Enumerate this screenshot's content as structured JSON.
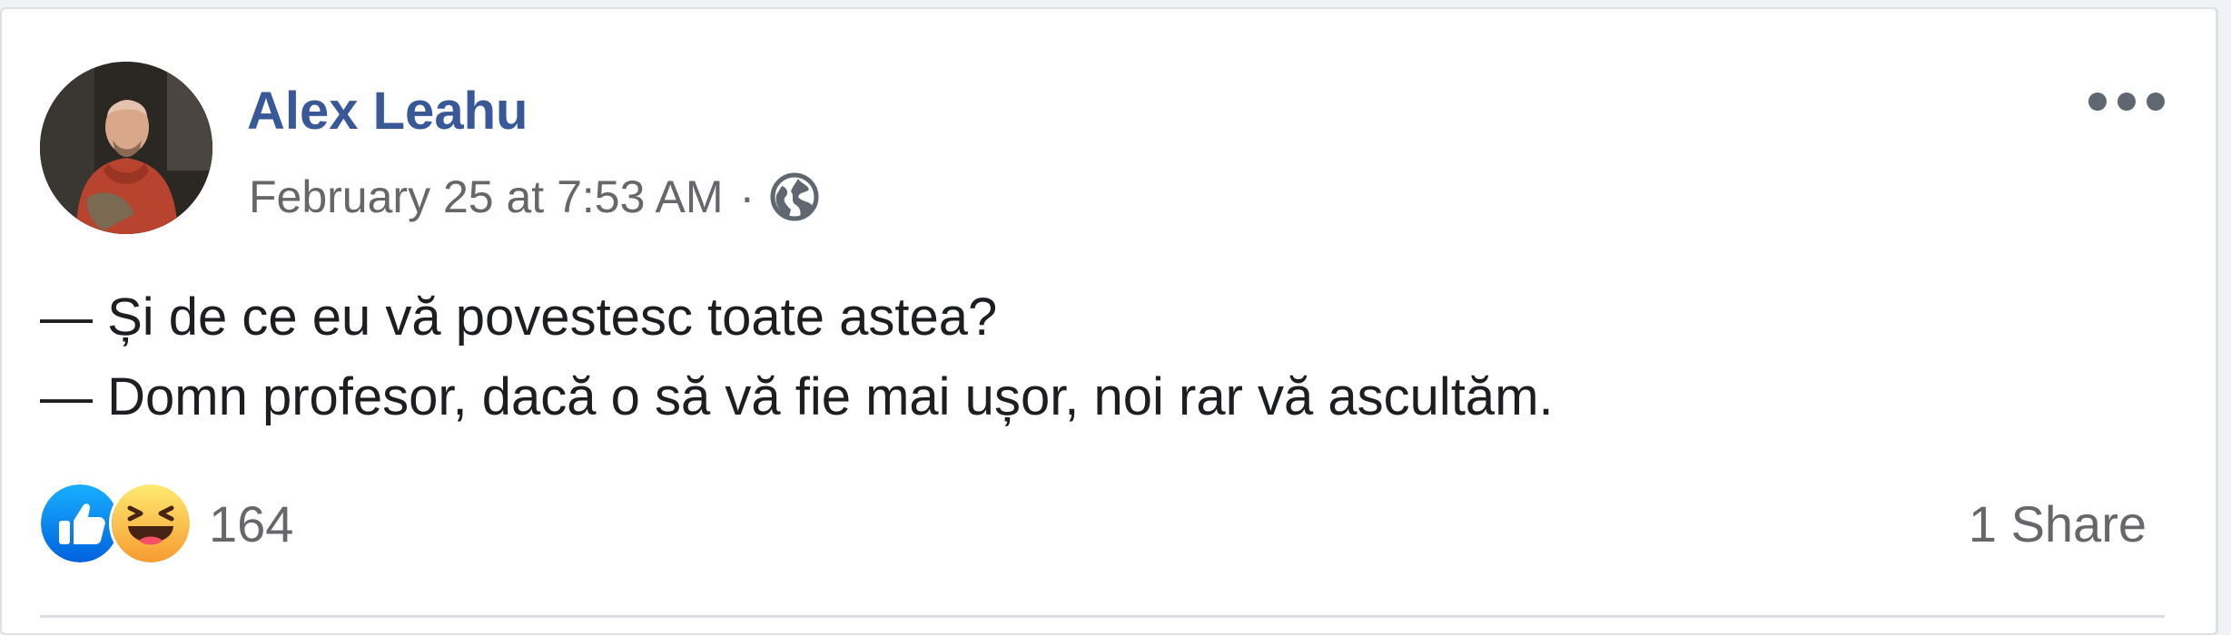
{
  "post": {
    "author": "Alex Leahu",
    "timestamp": "February 25 at 7:53 AM",
    "separator": "·",
    "privacy_icon": "globe-icon",
    "more_icon": "more-options-icon",
    "text_lines": [
      "— Și de ce eu vă povestesc toate astea?",
      "— Domn profesor, dacă o să vă fie mai ușor, noi rar vă ascultăm."
    ],
    "reactions": {
      "icons": [
        "like-icon",
        "haha-icon"
      ],
      "count": "164"
    },
    "shares": "1 Share"
  },
  "colors": {
    "author_link": "#385898",
    "meta_text": "#65676b",
    "body_text": "#1c1e21",
    "like_blue": "#1877f2",
    "haha_yellow": "#f7b125"
  }
}
